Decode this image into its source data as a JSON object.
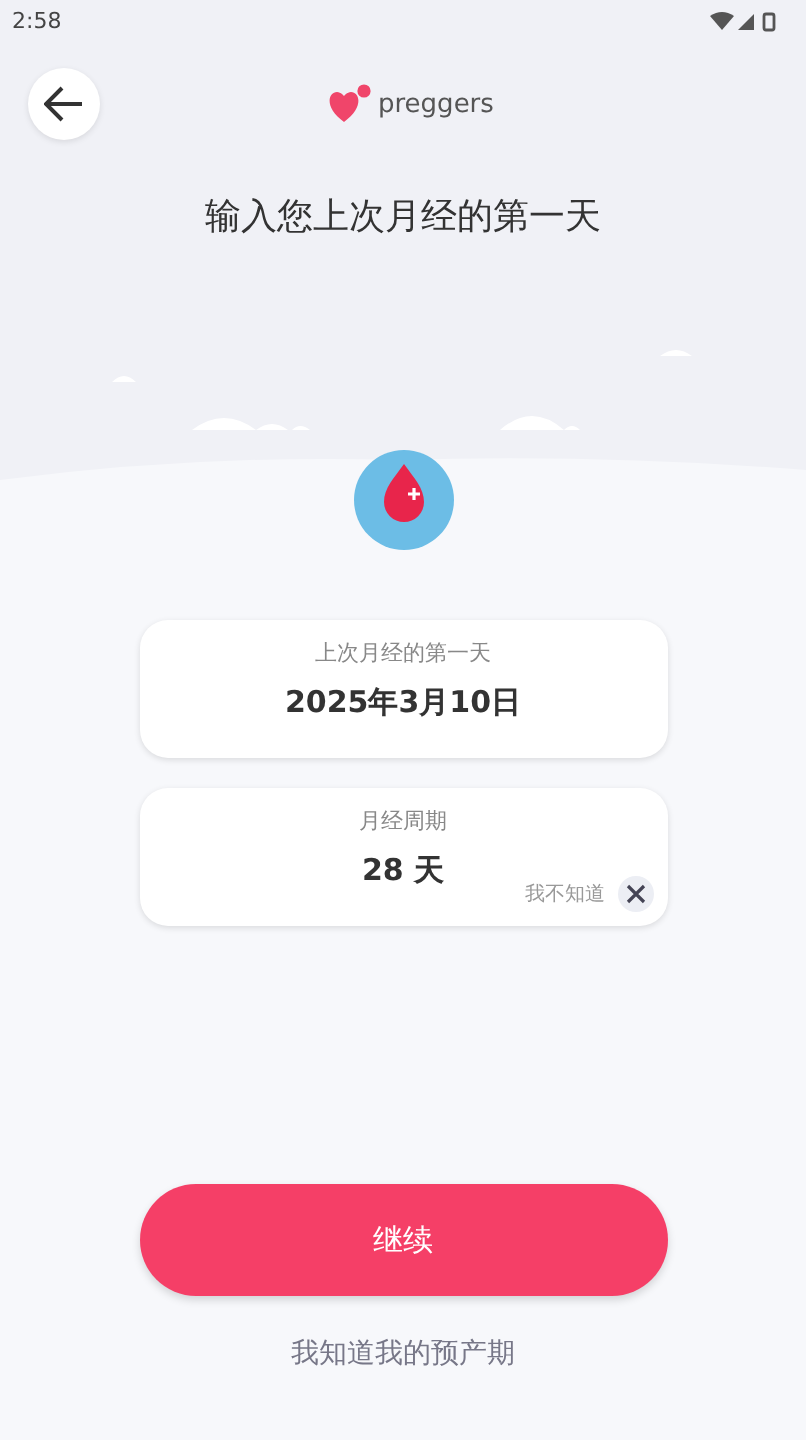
{
  "status_bar": {
    "time": "2:58"
  },
  "header": {
    "brand": "preggers"
  },
  "title": "输入您上次月经的第一天",
  "fields": [
    {
      "label": "上次月经的第一天",
      "value": "2025年3月10日"
    },
    {
      "label": "月经周期",
      "value": "28 天",
      "hint": "我不知道"
    }
  ],
  "primary_button": "继续",
  "link": "我知道我的预产期"
}
